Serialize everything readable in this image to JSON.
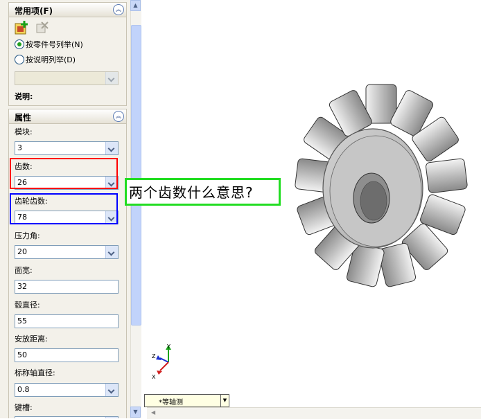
{
  "common": {
    "title": "常用项(F)",
    "radio_part_number": "按零件号列举(N)",
    "radio_description": "按说明列举(D)",
    "description_label": "说明:"
  },
  "props": {
    "title": "属性",
    "module_label": "模块:",
    "module_value": "3",
    "teeth_label": "齿数:",
    "teeth_value": "26",
    "gear_teeth_label": "齿轮齿数:",
    "gear_teeth_value": "78",
    "pressure_angle_label": "压力角:",
    "pressure_angle_value": "20",
    "face_width_label": "面宽:",
    "face_width_value": "32",
    "hub_diameter_label": "毂直径:",
    "hub_diameter_value": "55",
    "mounting_distance_label": "安放距离:",
    "mounting_distance_value": "50",
    "nominal_shaft_label": "标称轴直径:",
    "nominal_shaft_value": "0.8",
    "keyway_label": "键槽:"
  },
  "annotation": {
    "question": "两个齿数什么意思?"
  },
  "viewport": {
    "view_name": "*等轴测",
    "axis_x": "X",
    "axis_y": "Y",
    "axis_z": "Z"
  },
  "colors": {
    "highlight_teeth": "#ff0000",
    "highlight_gear_teeth": "#0000ff",
    "annotation_border": "#22dd22",
    "radio_selected": "#21a121"
  }
}
